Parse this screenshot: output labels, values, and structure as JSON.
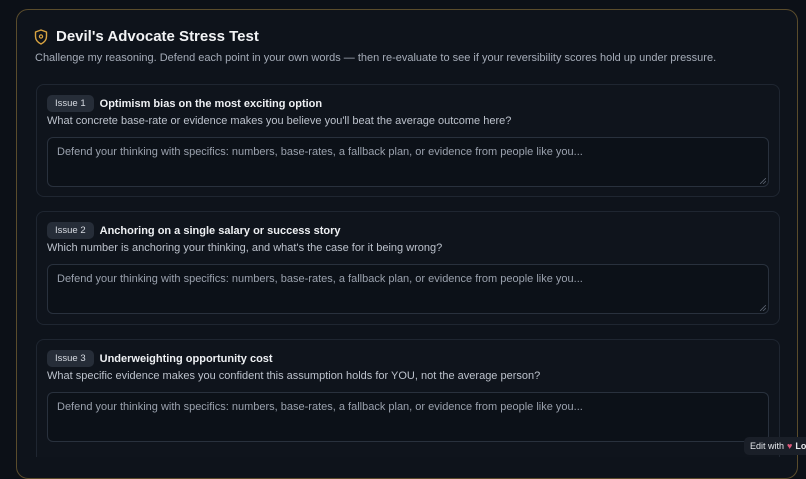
{
  "panel": {
    "title": "Devil's Advocate Stress Test",
    "subtitle": "Challenge my reasoning. Defend each point in your own words — then re-evaluate to see if your reversibility scores hold up under pressure.",
    "icon": "shield-icon",
    "accent_color": "#d9a441"
  },
  "issues": [
    {
      "badge": "Issue 1",
      "title": "Optimism bias on the most exciting option",
      "question": "What concrete base-rate or evidence makes you believe you'll beat the average outcome here?",
      "placeholder": "Defend your thinking with specifics: numbers, base-rates, a fallback plan, or evidence from people like you..."
    },
    {
      "badge": "Issue 2",
      "title": "Anchoring on a single salary or success story",
      "question": "Which number is anchoring your thinking, and what's the case for it being wrong?",
      "placeholder": "Defend your thinking with specifics: numbers, base-rates, a fallback plan, or evidence from people like you..."
    },
    {
      "badge": "Issue 3",
      "title": "Underweighting opportunity cost",
      "question": "What specific evidence makes you confident this assumption holds for YOU, not the average person?",
      "placeholder": "Defend your thinking with specifics: numbers, base-rates, a fallback plan, or evidence from people like you..."
    }
  ],
  "edit_badge": {
    "label": "Edit with",
    "brand": "Lov"
  }
}
